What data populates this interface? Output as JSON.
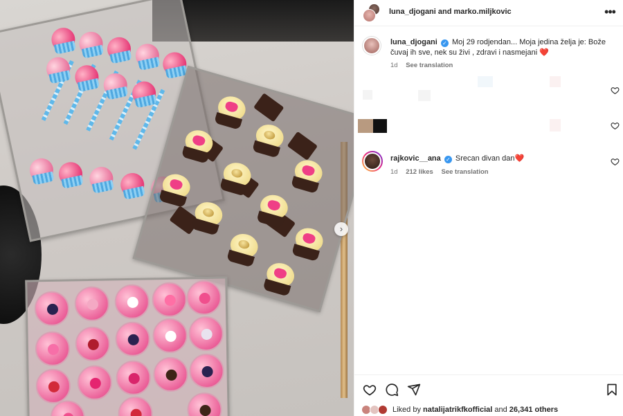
{
  "header": {
    "users_text": "luna_djogani and marko.miljkovic",
    "more_label": "•••"
  },
  "caption": {
    "username": "luna_djogani",
    "verified_mark": "✓",
    "text": "Moj 29 rodjendan... Moja jedina želja je: Bože čuvaj ih sve, nek su živi , zdravi i nasmejani",
    "emoji": "❤️",
    "time": "1d",
    "translation_label": "See translation"
  },
  "comment": {
    "username": "rajkovic__ana",
    "verified_mark": "✓",
    "text": "Srecan divan dan",
    "emoji": "❤️",
    "time": "1d",
    "likes": "212 likes",
    "translation_label": "See translation"
  },
  "post_image": {
    "next_arrow": "›"
  },
  "likes_row": {
    "prefix": "Liked by",
    "user": "natalijatrikfkofficial",
    "joiner": "and",
    "others": "26,341 others"
  },
  "icons": {
    "like": "heart-icon",
    "comment": "comment-icon",
    "share": "send-icon",
    "save": "bookmark-icon",
    "more": "more-icon",
    "verified": "verified-badge-icon",
    "next": "chevron-right-icon"
  },
  "colors": {
    "verified_blue": "#3897f0",
    "heart_red": "#ed4956",
    "text_primary": "#262626",
    "text_secondary": "#737373"
  }
}
